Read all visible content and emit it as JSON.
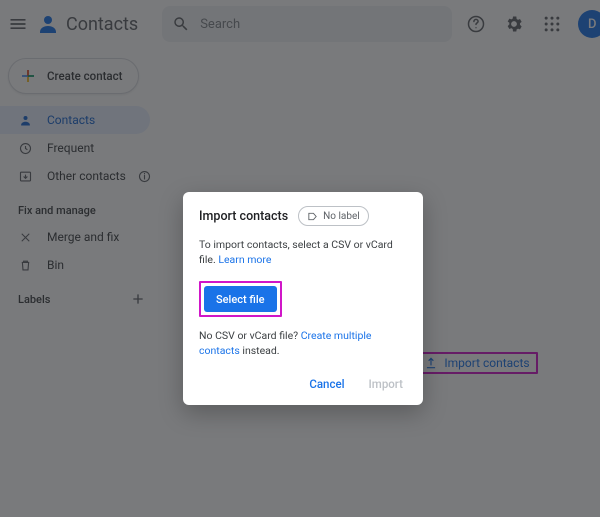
{
  "header": {
    "app_name": "Contacts",
    "search_placeholder": "Search",
    "avatar_letter": "D"
  },
  "sidebar": {
    "create_label": "Create contact",
    "nav": [
      {
        "label": "Contacts"
      },
      {
        "label": "Frequent"
      },
      {
        "label": "Other contacts"
      }
    ],
    "section_title": "Fix and manage",
    "fix_items": [
      {
        "label": "Merge and fix"
      },
      {
        "label": "Bin"
      }
    ],
    "labels_title": "Labels"
  },
  "main_actions": {
    "create": "Create contact",
    "import": "Import contacts"
  },
  "dialog": {
    "title": "Import contacts",
    "chip_label": "No label",
    "body_prefix": "To import contacts, select a CSV or vCard file. ",
    "learn_more": "Learn more",
    "select_file": "Select file",
    "no_file_prefix": "No CSV or vCard file? ",
    "create_multiple": "Create multiple contacts",
    "no_file_suffix": " instead.",
    "cancel": "Cancel",
    "import": "Import"
  }
}
